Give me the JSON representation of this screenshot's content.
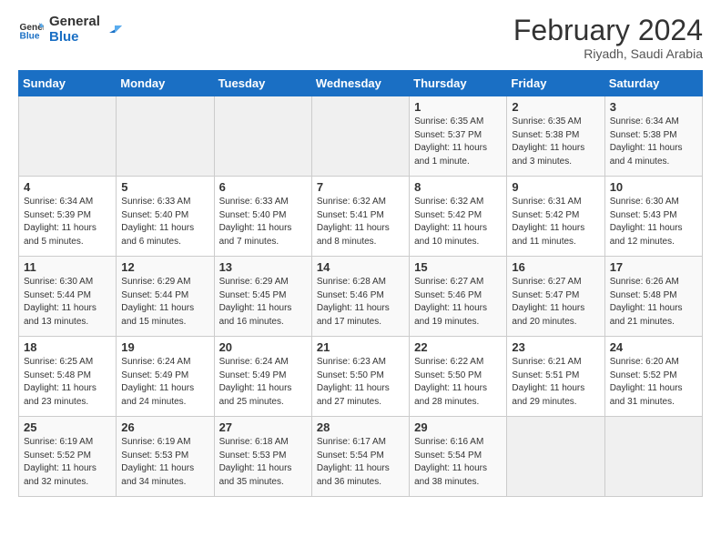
{
  "header": {
    "logo_line1": "General",
    "logo_line2": "Blue",
    "title": "February 2024",
    "subtitle": "Riyadh, Saudi Arabia"
  },
  "weekdays": [
    "Sunday",
    "Monday",
    "Tuesday",
    "Wednesday",
    "Thursday",
    "Friday",
    "Saturday"
  ],
  "weeks": [
    [
      {
        "day": "",
        "info": ""
      },
      {
        "day": "",
        "info": ""
      },
      {
        "day": "",
        "info": ""
      },
      {
        "day": "",
        "info": ""
      },
      {
        "day": "1",
        "info": "Sunrise: 6:35 AM\nSunset: 5:37 PM\nDaylight: 11 hours\nand 1 minute."
      },
      {
        "day": "2",
        "info": "Sunrise: 6:35 AM\nSunset: 5:38 PM\nDaylight: 11 hours\nand 3 minutes."
      },
      {
        "day": "3",
        "info": "Sunrise: 6:34 AM\nSunset: 5:38 PM\nDaylight: 11 hours\nand 4 minutes."
      }
    ],
    [
      {
        "day": "4",
        "info": "Sunrise: 6:34 AM\nSunset: 5:39 PM\nDaylight: 11 hours\nand 5 minutes."
      },
      {
        "day": "5",
        "info": "Sunrise: 6:33 AM\nSunset: 5:40 PM\nDaylight: 11 hours\nand 6 minutes."
      },
      {
        "day": "6",
        "info": "Sunrise: 6:33 AM\nSunset: 5:40 PM\nDaylight: 11 hours\nand 7 minutes."
      },
      {
        "day": "7",
        "info": "Sunrise: 6:32 AM\nSunset: 5:41 PM\nDaylight: 11 hours\nand 8 minutes."
      },
      {
        "day": "8",
        "info": "Sunrise: 6:32 AM\nSunset: 5:42 PM\nDaylight: 11 hours\nand 10 minutes."
      },
      {
        "day": "9",
        "info": "Sunrise: 6:31 AM\nSunset: 5:42 PM\nDaylight: 11 hours\nand 11 minutes."
      },
      {
        "day": "10",
        "info": "Sunrise: 6:30 AM\nSunset: 5:43 PM\nDaylight: 11 hours\nand 12 minutes."
      }
    ],
    [
      {
        "day": "11",
        "info": "Sunrise: 6:30 AM\nSunset: 5:44 PM\nDaylight: 11 hours\nand 13 minutes."
      },
      {
        "day": "12",
        "info": "Sunrise: 6:29 AM\nSunset: 5:44 PM\nDaylight: 11 hours\nand 15 minutes."
      },
      {
        "day": "13",
        "info": "Sunrise: 6:29 AM\nSunset: 5:45 PM\nDaylight: 11 hours\nand 16 minutes."
      },
      {
        "day": "14",
        "info": "Sunrise: 6:28 AM\nSunset: 5:46 PM\nDaylight: 11 hours\nand 17 minutes."
      },
      {
        "day": "15",
        "info": "Sunrise: 6:27 AM\nSunset: 5:46 PM\nDaylight: 11 hours\nand 19 minutes."
      },
      {
        "day": "16",
        "info": "Sunrise: 6:27 AM\nSunset: 5:47 PM\nDaylight: 11 hours\nand 20 minutes."
      },
      {
        "day": "17",
        "info": "Sunrise: 6:26 AM\nSunset: 5:48 PM\nDaylight: 11 hours\nand 21 minutes."
      }
    ],
    [
      {
        "day": "18",
        "info": "Sunrise: 6:25 AM\nSunset: 5:48 PM\nDaylight: 11 hours\nand 23 minutes."
      },
      {
        "day": "19",
        "info": "Sunrise: 6:24 AM\nSunset: 5:49 PM\nDaylight: 11 hours\nand 24 minutes."
      },
      {
        "day": "20",
        "info": "Sunrise: 6:24 AM\nSunset: 5:49 PM\nDaylight: 11 hours\nand 25 minutes."
      },
      {
        "day": "21",
        "info": "Sunrise: 6:23 AM\nSunset: 5:50 PM\nDaylight: 11 hours\nand 27 minutes."
      },
      {
        "day": "22",
        "info": "Sunrise: 6:22 AM\nSunset: 5:50 PM\nDaylight: 11 hours\nand 28 minutes."
      },
      {
        "day": "23",
        "info": "Sunrise: 6:21 AM\nSunset: 5:51 PM\nDaylight: 11 hours\nand 29 minutes."
      },
      {
        "day": "24",
        "info": "Sunrise: 6:20 AM\nSunset: 5:52 PM\nDaylight: 11 hours\nand 31 minutes."
      }
    ],
    [
      {
        "day": "25",
        "info": "Sunrise: 6:19 AM\nSunset: 5:52 PM\nDaylight: 11 hours\nand 32 minutes."
      },
      {
        "day": "26",
        "info": "Sunrise: 6:19 AM\nSunset: 5:53 PM\nDaylight: 11 hours\nand 34 minutes."
      },
      {
        "day": "27",
        "info": "Sunrise: 6:18 AM\nSunset: 5:53 PM\nDaylight: 11 hours\nand 35 minutes."
      },
      {
        "day": "28",
        "info": "Sunrise: 6:17 AM\nSunset: 5:54 PM\nDaylight: 11 hours\nand 36 minutes."
      },
      {
        "day": "29",
        "info": "Sunrise: 6:16 AM\nSunset: 5:54 PM\nDaylight: 11 hours\nand 38 minutes."
      },
      {
        "day": "",
        "info": ""
      },
      {
        "day": "",
        "info": ""
      }
    ]
  ]
}
